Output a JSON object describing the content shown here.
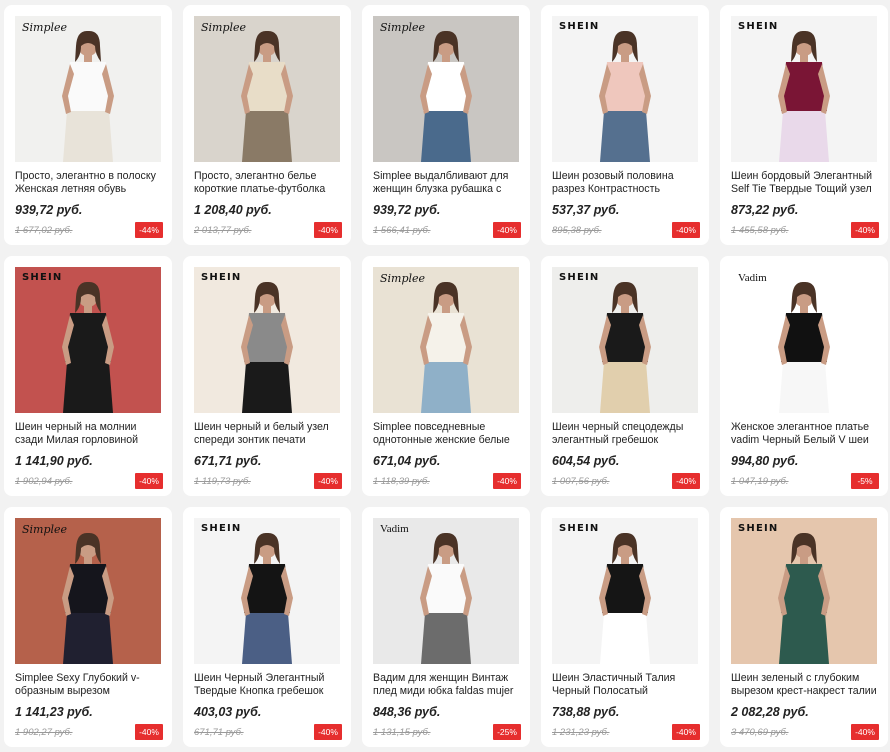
{
  "colors": {
    "accent": "#e62e2e",
    "background": "#f2f2f2",
    "card": "#ffffff"
  },
  "products": [
    {
      "brand": "Simplee",
      "brand_style": "script",
      "title": "Просто, элегантно в полоску Женская летняя обувь",
      "price": "939,72 руб.",
      "old_price": "1 677,02 руб.",
      "discount": "-44%",
      "image": "white-button-dress",
      "bg": "#f1f1ef",
      "fig": "#fafafa",
      "fig2": "#e8e3d9"
    },
    {
      "brand": "Simplee",
      "brand_style": "script",
      "title": "Просто, элегантно белье короткие платье-футболка",
      "price": "1 208,40 руб.",
      "old_price": "2 013,77 руб.",
      "discount": "-40%",
      "image": "beige-shirt-dress",
      "bg": "#d9d4cc",
      "fig": "#e8ddc8",
      "fig2": "#8a7a66"
    },
    {
      "brand": "Simplee",
      "brand_style": "script",
      "title": "Simplee выдалбливают для женщин блузка рубашка с",
      "price": "939,72 руб.",
      "old_price": "1 566,41 руб.",
      "discount": "-40%",
      "image": "white-lace-blouse",
      "bg": "#c9c6c2",
      "fig": "#ffffff",
      "fig2": "#4a6a8c"
    },
    {
      "brand": "SHEIN",
      "brand_style": "caps",
      "title": "Шеин розовый половина разрез Контрастность",
      "price": "537,37 руб.",
      "old_price": "895,38 руб.",
      "discount": "-40%",
      "image": "pink-top",
      "bg": "#f4f4f4",
      "fig": "#efc7bd",
      "fig2": "#55708f"
    },
    {
      "brand": "SHEIN",
      "brand_style": "caps",
      "title": "Шеин бордовый Элегантный Self Tie Твердые Тощий узел",
      "price": "873,22 руб.",
      "old_price": "1 455,58 руб.",
      "discount": "-40%",
      "image": "burgundy-pants",
      "bg": "#f4f4f4",
      "fig": "#7a1535",
      "fig2": "#e9d9ea"
    },
    {
      "brand": "SHEIN",
      "brand_style": "caps",
      "title": "Шеин черный на молнии сзади Милая горловиной",
      "price": "1 141,90 руб.",
      "old_price": "1 902,94 руб.",
      "discount": "-40%",
      "image": "black-jumpsuit",
      "bg": "#c2524f",
      "fig": "#1a1a1a",
      "fig2": "#1a1a1a"
    },
    {
      "brand": "SHEIN",
      "brand_style": "caps",
      "title": "Шеин черный и белый узел спереди зонтик печати",
      "price": "671,71 руб.",
      "old_price": "1 119,73 руб.",
      "discount": "-40%",
      "image": "gingham-top",
      "bg": "#f1e9df",
      "fig": "#8a8a8a",
      "fig2": "#1a1a1a"
    },
    {
      "brand": "Simplee",
      "brand_style": "script",
      "title": "Simplee повседневные однотонные женские белые",
      "price": "671,04 руб.",
      "old_price": "1 118,39 руб.",
      "discount": "-40%",
      "image": "white-halter-top",
      "bg": "#e9e2d4",
      "fig": "#f5f2ea",
      "fig2": "#8fb0c8"
    },
    {
      "brand": "SHEIN",
      "brand_style": "caps",
      "title": "Шеин черный спецодежды элегантный гребешок",
      "price": "604,54 руб.",
      "old_price": "1 007,56 руб.",
      "discount": "-40%",
      "image": "black-scallop-top",
      "bg": "#eeeeec",
      "fig": "#1a1a1a",
      "fig2": "#e1cfad"
    },
    {
      "brand": "Vadim",
      "brand_style": "serif",
      "title": "Женское элегантное платье vadim Черный Белый V шеи",
      "price": "994,80 руб.",
      "old_price": "1 047,19 руб.",
      "discount": "-5%",
      "image": "blazers",
      "bg": "#ffffff",
      "fig": "#111111",
      "fig2": "#f7f7f7"
    },
    {
      "brand": "Simplee",
      "brand_style": "script",
      "title": "Simplee Sexy Глубокий v-образным вырезом блестками",
      "price": "1 141,23 руб.",
      "old_price": "1 902,27 руб.",
      "discount": "-40%",
      "image": "sequin-dress",
      "bg": "#b5614b",
      "fig": "#15151c",
      "fig2": "#202030"
    },
    {
      "brand": "SHEIN",
      "brand_style": "caps",
      "title": "Шеин Черный Элегантный Твердые Кнопка гребешок",
      "price": "403,03 руб.",
      "old_price": "671,71 руб.",
      "discount": "-40%",
      "image": "black-sleeveless-top",
      "bg": "#f4f4f4",
      "fig": "#141414",
      "fig2": "#4b5f85"
    },
    {
      "brand": "Vadim",
      "brand_style": "serif",
      "title": "Вадим для женщин Винтаж плед миди юбка faldas mujer",
      "price": "848,36 руб.",
      "old_price": "1 131,15 руб.",
      "discount": "-25%",
      "image": "plaid-skirt",
      "bg": "#e9e9e9",
      "fig": "#fafafa",
      "fig2": "#6c6c6c"
    },
    {
      "brand": "SHEIN",
      "brand_style": "caps",
      "title": "Шеин Эластичный Талия Черный Полосатый",
      "price": "738,88 руб.",
      "old_price": "1 231,23 руб.",
      "discount": "-40%",
      "image": "black-leggings",
      "bg": "#f4f4f4",
      "fig": "#151515",
      "fig2": "#ffffff"
    },
    {
      "brand": "SHEIN",
      "brand_style": "caps",
      "title": "Шеин зеленый с глубоким вырезом крест-накрест талии",
      "price": "2 082,28 руб.",
      "old_price": "3 470,69 руб.",
      "discount": "-40%",
      "image": "green-maxi-dress",
      "bg": "#e5c6ad",
      "fig": "#2d5a4e",
      "fig2": "#2d5a4e"
    }
  ]
}
